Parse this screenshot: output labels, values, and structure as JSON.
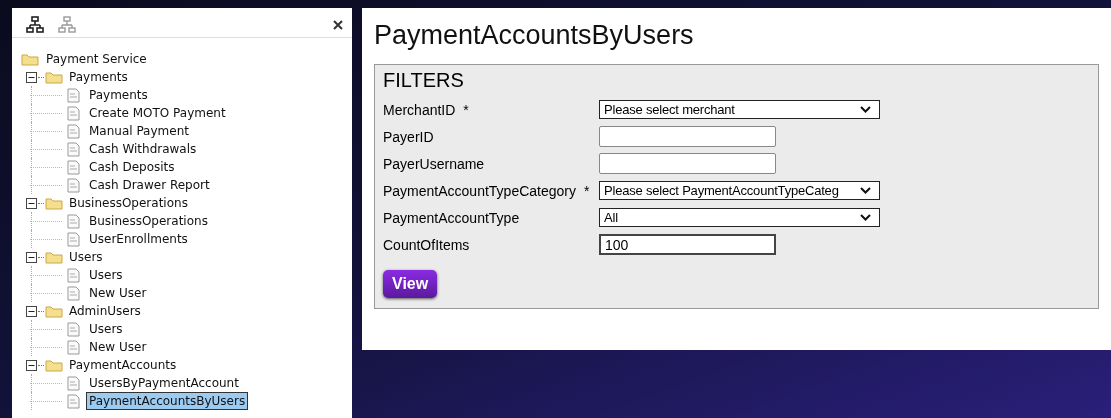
{
  "tree": {
    "label": "Payment Service",
    "expanded": true,
    "children": [
      {
        "label": "Payments",
        "expanded": true,
        "children": [
          {
            "label": "Payments",
            "selected": false
          },
          {
            "label": "Create MOTO Payment",
            "selected": false
          },
          {
            "label": "Manual Payment",
            "selected": false
          },
          {
            "label": "Cash Withdrawals",
            "selected": false
          },
          {
            "label": "Cash Deposits",
            "selected": false
          },
          {
            "label": "Cash Drawer Report",
            "selected": false
          }
        ]
      },
      {
        "label": "BusinessOperations",
        "expanded": true,
        "children": [
          {
            "label": "BusinessOperations",
            "selected": false
          },
          {
            "label": "UserEnrollments",
            "selected": false
          }
        ]
      },
      {
        "label": "Users",
        "expanded": true,
        "children": [
          {
            "label": "Users",
            "selected": false
          },
          {
            "label": "New User",
            "selected": false
          }
        ]
      },
      {
        "label": "AdminUsers",
        "expanded": true,
        "children": [
          {
            "label": "Users",
            "selected": false
          },
          {
            "label": "New User",
            "selected": false
          }
        ]
      },
      {
        "label": "PaymentAccounts",
        "expanded": true,
        "children": [
          {
            "label": "UsersByPaymentAccount",
            "selected": false
          },
          {
            "label": "PaymentAccountsByUsers",
            "selected": true
          }
        ]
      }
    ]
  },
  "page": {
    "title": "PaymentAccountsByUsers"
  },
  "filters": {
    "heading": "FILTERS",
    "fields": [
      {
        "label": "MerchantID",
        "required_mark": "*",
        "kind": "select",
        "value": "Please select merchant"
      },
      {
        "label": "PayerID",
        "kind": "input"
      },
      {
        "label": "PayerUsername",
        "kind": "input"
      },
      {
        "label": "PaymentAccountTypeCategory",
        "required_mark": "*",
        "kind": "select",
        "value": "Please select PaymentAccountTypeCateg"
      },
      {
        "label": "PaymentAccountType",
        "kind": "select",
        "value": "All"
      },
      {
        "label": "CountOfItems",
        "kind": "input",
        "value": "100"
      }
    ],
    "button": "View"
  }
}
